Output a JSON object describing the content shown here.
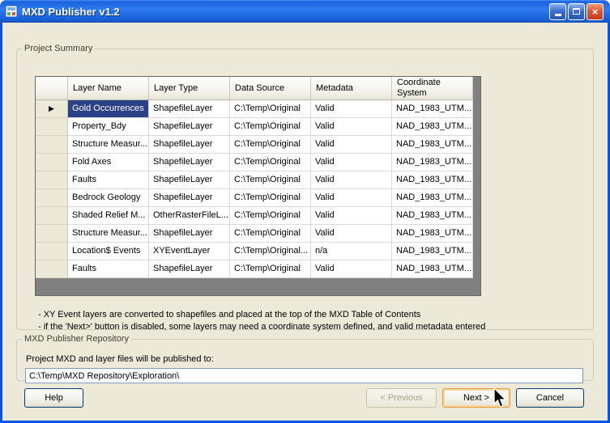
{
  "window": {
    "title": "MXD Publisher v1.2"
  },
  "project_summary": {
    "label": "Project Summary",
    "grid": {
      "columns": [
        "Layer Name",
        "Layer Type",
        "Data Source",
        "Metadata",
        "Coordinate System"
      ],
      "rows": [
        {
          "selected": true,
          "layer_name": "Gold Occurrences",
          "layer_type": "ShapefileLayer",
          "data_source": "C:\\Temp\\Original",
          "metadata": "Valid",
          "coordinate_system": "NAD_1983_UTM..."
        },
        {
          "selected": false,
          "layer_name": "Property_Bdy",
          "layer_type": "ShapefileLayer",
          "data_source": "C:\\Temp\\Original",
          "metadata": "Valid",
          "coordinate_system": "NAD_1983_UTM..."
        },
        {
          "selected": false,
          "layer_name": "Structure Measur...",
          "layer_type": "ShapefileLayer",
          "data_source": "C:\\Temp\\Original",
          "metadata": "Valid",
          "coordinate_system": "NAD_1983_UTM..."
        },
        {
          "selected": false,
          "layer_name": "Fold Axes",
          "layer_type": "ShapefileLayer",
          "data_source": "C:\\Temp\\Original",
          "metadata": "Valid",
          "coordinate_system": "NAD_1983_UTM..."
        },
        {
          "selected": false,
          "layer_name": "Faults",
          "layer_type": "ShapefileLayer",
          "data_source": "C:\\Temp\\Original",
          "metadata": "Valid",
          "coordinate_system": "NAD_1983_UTM..."
        },
        {
          "selected": false,
          "layer_name": "Bedrock Geology",
          "layer_type": "ShapefileLayer",
          "data_source": "C:\\Temp\\Original",
          "metadata": "Valid",
          "coordinate_system": "NAD_1983_UTM..."
        },
        {
          "selected": false,
          "layer_name": "Shaded Relief M...",
          "layer_type": "OtherRasterFileL...",
          "data_source": "C:\\Temp\\Original",
          "metadata": "Valid",
          "coordinate_system": "NAD_1983_UTM..."
        },
        {
          "selected": false,
          "layer_name": "Structure Measur...",
          "layer_type": "ShapefileLayer",
          "data_source": "C:\\Temp\\Original",
          "metadata": "Valid",
          "coordinate_system": "NAD_1983_UTM..."
        },
        {
          "selected": false,
          "layer_name": "Location$ Events",
          "layer_type": "XYEventLayer",
          "data_source": "C:\\Temp\\Original...",
          "metadata": "n/a",
          "coordinate_system": "NAD_1983_UTM..."
        },
        {
          "selected": false,
          "layer_name": "Faults",
          "layer_type": "ShapefileLayer",
          "data_source": "C:\\Temp\\Original",
          "metadata": "Valid",
          "coordinate_system": "NAD_1983_UTM..."
        }
      ]
    },
    "notes": [
      "- XY Event layers are converted to shapefiles and placed at the top of the MXD Table of Contents",
      "- if the 'Next>' button is disabled, some layers may need a coordinate system defined, and valid metadata entered"
    ]
  },
  "repository": {
    "label": "MXD Publisher Repository",
    "description": "Project MXD and layer files will be published to:",
    "path": "C:\\Temp\\MXD Repository\\Exploration\\"
  },
  "buttons": {
    "help": "Help",
    "previous": "< Previous",
    "next": "Next >",
    "cancel": "Cancel"
  }
}
